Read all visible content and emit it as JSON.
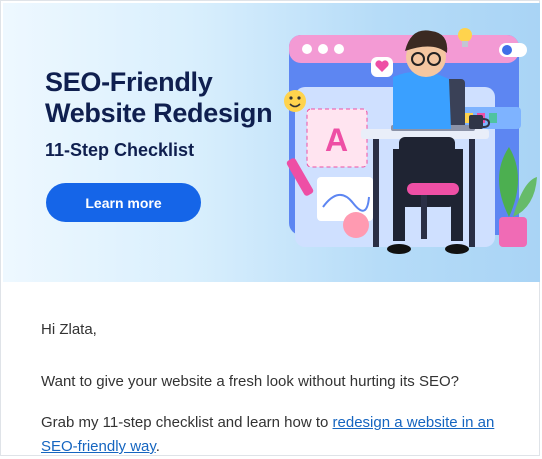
{
  "hero": {
    "title": "SEO-Friendly\nWebsite Redesign",
    "subtitle": "11-Step Checklist",
    "cta_label": "Learn more",
    "colors": {
      "accent": "#1565e8",
      "title": "#0f1f4f",
      "pink": "#ee4fa5"
    }
  },
  "body": {
    "greeting": "Hi Zlata,",
    "para1": "Want to give your website a fresh look without hurting its SEO?",
    "para2_prefix": "Grab my 11-step checklist and learn how to ",
    "para2_link": "redesign a website in an SEO-friendly way",
    "para2_suffix": "."
  },
  "icons": [
    "smiley-icon",
    "heart-icon",
    "lightbulb-icon",
    "toggle-icon",
    "coffee-mug-icon",
    "pencil-icon",
    "plant-icon",
    "laptop-icon"
  ]
}
